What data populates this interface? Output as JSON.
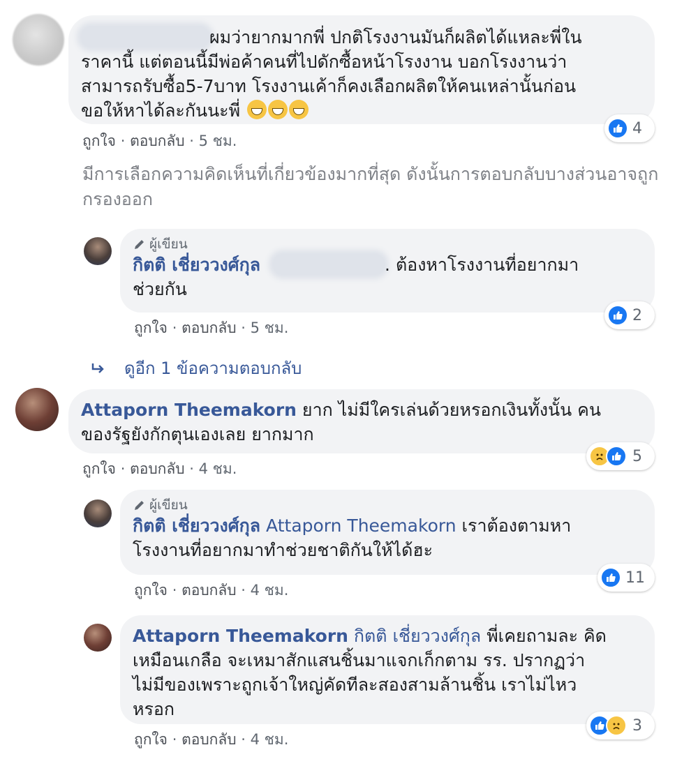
{
  "comments": [
    {
      "id": "c1",
      "text": "ผมว่ายากมากพี่ ปกติโรงงานมันก็ผลิตได้แหละพี่ใน\nราคานี้ แต่ตอนนี้มีพ่อค้าคนที่ไปดักซื้อหน้าโรงงาน บอกโรงงานว่า\nสามารถรับซื้อ5-7บาท โรงงานเค้าก็คงเลือกผลิตให้คนเหล่านั้นก่อน\nขอให้หาได้ละกันนะพี่ ",
      "like": "ถูกใจ",
      "reply": "ตอบกลับ",
      "time": "5 ชม.",
      "reactions": "4"
    },
    {
      "id": "r1",
      "author_badge": "ผู้เขียน",
      "name": "กิตติ เชี่ยววงศ์กุล",
      "text_after": ". ต้องหาโรงงานที่อยากมา\nช่วยกัน",
      "like": "ถูกใจ",
      "reply": "ตอบกลับ",
      "time": "5 ชม.",
      "reactions": "2"
    },
    {
      "id": "c2",
      "name": "Attaporn Theemakorn",
      "text": "ยาก ไม่มีใครเล่นด้วยหรอกเงินทั้งนั้น คน\nของรัฐยังกักตุนเองเลย ยากมาก",
      "like": "ถูกใจ",
      "reply": "ตอบกลับ",
      "time": "4 ชม.",
      "reactions": "5"
    },
    {
      "id": "r2",
      "author_badge": "ผู้เขียน",
      "name": "กิตติ เชี่ยววงศ์กุล",
      "tag": "Attaporn Theemakorn",
      "text": "เราต้องตามหา\nโรงงานที่อยากมาทำช่วยชาติกันให้ได้ฮะ",
      "like": "ถูกใจ",
      "reply": "ตอบกลับ",
      "time": "4 ชม.",
      "reactions": "11"
    },
    {
      "id": "r3",
      "name": "Attaporn Theemakorn",
      "tag": "กิตติ เชี่ยววงศ์กุล",
      "text": "พี่เคยถามละ คิด\nเหมือนเกลือ จะเหมาสักแสนชิ้นมาแจกเก็กตาม รร. ปรากฏว่า\nไม่มีของเพราะถูกเจ้าใหญ่คัดทีละสองสามล้านชิ้น เราไม่ไหว\nหรอก",
      "like": "ถูกใจ",
      "reply": "ตอบกลับ",
      "time": "4 ชม.",
      "reactions": "3"
    }
  ],
  "notice": "มีการเลือกความคิดเห็นที่เกี่ยวข้องมากที่สุด ดังนั้นการตอบกลับบางส่วนอาจถูกกรองออก",
  "view_more": "ดูอีก 1 ข้อความตอบกลับ",
  "separator": "·",
  "colors": {
    "name": "#385898",
    "bubble": "#f2f3f5",
    "like_blue": "#1877f2",
    "meta": "#606770"
  }
}
